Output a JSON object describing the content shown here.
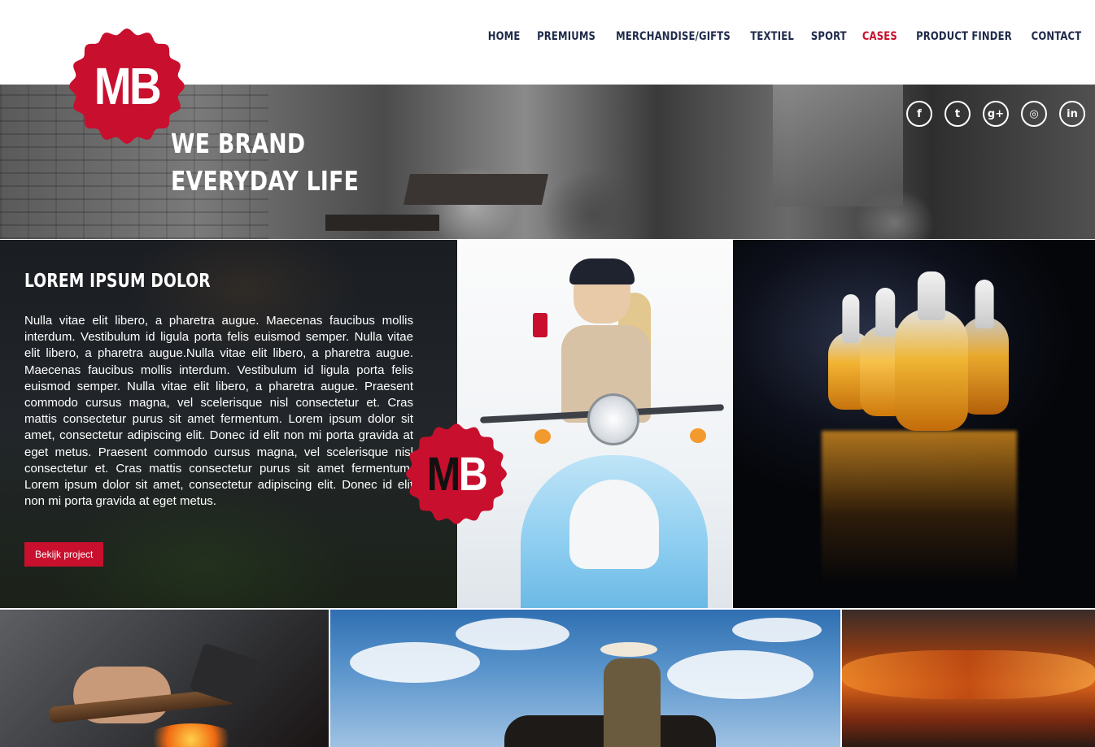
{
  "brand": {
    "logo_text": "MB",
    "colors": {
      "primary_red": "#c8102e",
      "nav_text": "#1f2a4a",
      "white": "#ffffff"
    }
  },
  "nav": {
    "items": [
      {
        "label": "HOME",
        "active": false
      },
      {
        "label": "PREMIUMS",
        "active": false
      },
      {
        "label": "MERCHANDISE/GIFTS",
        "active": false
      },
      {
        "label": "TEXTIEL",
        "active": false
      },
      {
        "label": "SPORT",
        "active": false
      },
      {
        "label": "CASES",
        "active": true
      },
      {
        "label": "PRODUCT FINDER",
        "active": false
      },
      {
        "label": "CONTACT",
        "active": false
      }
    ]
  },
  "hero": {
    "title_line1": "WE BRAND",
    "title_line2": "EVERYDAY LIFE"
  },
  "socials": [
    {
      "icon": "facebook-icon",
      "glyph": "f"
    },
    {
      "icon": "twitter-icon",
      "glyph": "t"
    },
    {
      "icon": "google-plus-icon",
      "glyph": "g+"
    },
    {
      "icon": "instagram-icon",
      "glyph": "◎"
    },
    {
      "icon": "linkedin-icon",
      "glyph": "in"
    }
  ],
  "case": {
    "heading": "LOREM IPSUM DOLOR",
    "body": "Nulla vitae elit libero, a pharetra augue. Maecenas faucibus mollis interdum. Vestibulum id ligula porta felis euismod semper. Nulla vitae elit libero, a pharetra augue.Nulla vitae elit libero, a pharetra augue. Maecenas faucibus mollis interdum. Vestibulum id ligula porta felis euismod semper. Nulla vitae elit libero, a pharetra augue. Praesent commodo cursus magna, vel scelerisque nisl consectetur et. Cras mattis consectetur purus sit amet fermentum. Lorem ipsum dolor sit amet, consectetur adipiscing elit. Donec id elit non mi porta gravida at eget metus. Praesent commodo cursus magna, vel scelerisque nisl consectetur et. Cras mattis consectetur purus sit amet fermentum. Lorem ipsum dolor sit amet, consectetur adipiscing elit. Donec id elit non mi porta gravida at eget metus.",
    "button_label": "Bekijk project"
  },
  "badge": {
    "text": "MB"
  }
}
